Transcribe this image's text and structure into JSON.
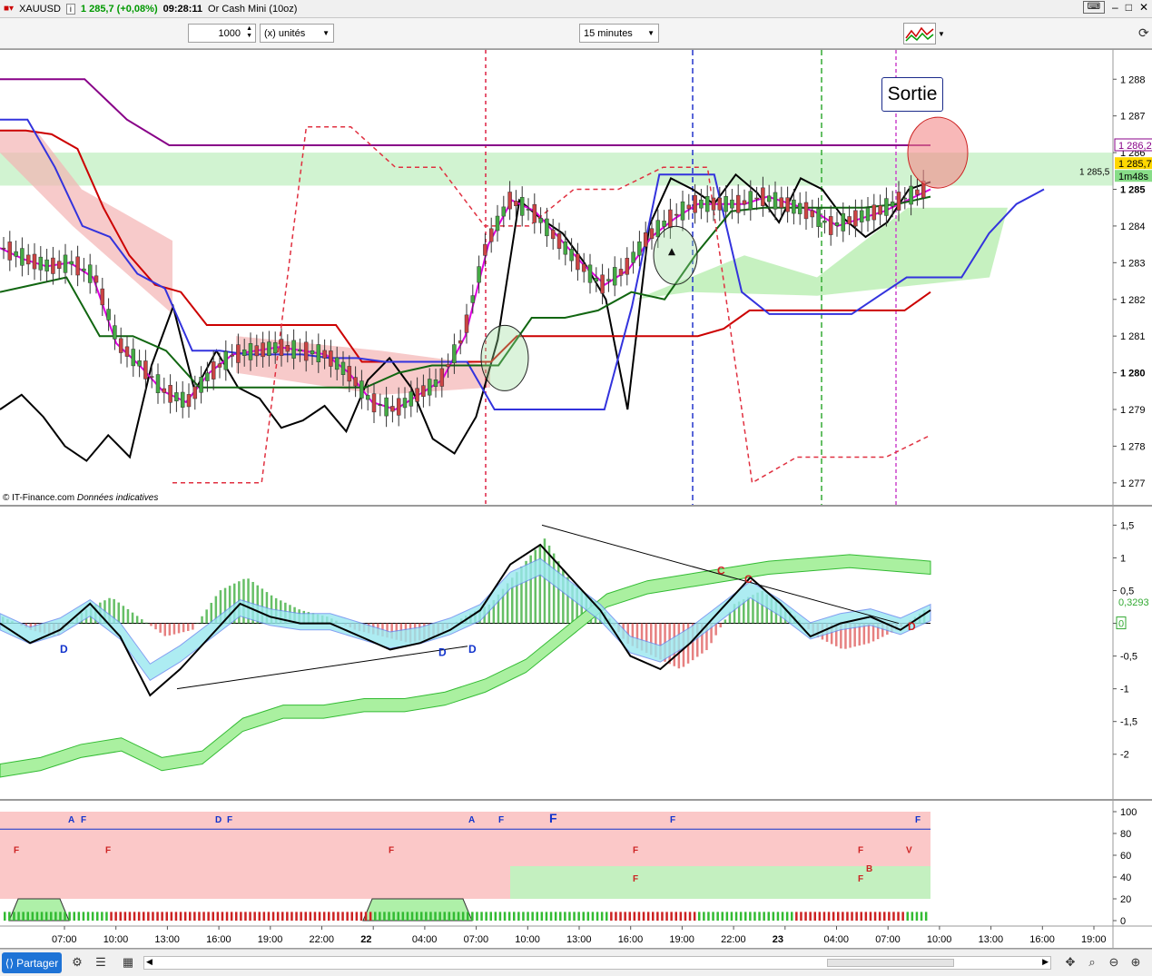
{
  "title_bar": {
    "symbol": "XAUUSD",
    "info_icon": "info-icon",
    "price_change": "1 285,7 (+0,08%)",
    "time": "09:28:11",
    "instrument": "Or Cash Mini (10oz)"
  },
  "toolbar": {
    "quantity": "1000",
    "unit": "(x) unités",
    "timeframe": "15 minutes"
  },
  "annotation": {
    "sortie": "Sortie"
  },
  "watermark": {
    "source": "© IT-Finance.com",
    "note": "Données indicatives"
  },
  "price_labels": {
    "purple": "1 286,2",
    "current": "1 285,7",
    "countdown": "1m48s",
    "band": "1 285,5"
  },
  "osc_labels": {
    "value": "0,3293",
    "zero": "0"
  },
  "lower_letters": {
    "blue": [
      "A",
      "F",
      "D",
      "F",
      "A",
      "F",
      "F",
      "F",
      "F"
    ],
    "red": [
      "F",
      "F",
      "F",
      "F",
      "F",
      "V",
      "F",
      "F",
      "B"
    ]
  },
  "osc_letters": [
    "D",
    "D",
    "D",
    "C",
    "C",
    "D"
  ],
  "statusbar": {
    "share": "Partager"
  },
  "chart_data": [
    {
      "type": "line",
      "title": "",
      "ylim": [
        1276.6,
        1288.6
      ],
      "yticks": [
        "1 288",
        "1 287",
        "1 286",
        "1 285",
        "1 284",
        "1 283",
        "1 282",
        "1 281",
        "1 280",
        "1 279",
        "1 278",
        "1 277"
      ],
      "series": [
        {
          "color": "#000000",
          "values": [
            1279.0,
            1279.4,
            1278.8,
            1278.0,
            1277.6,
            1278.3,
            1277.7,
            1280.2,
            1281.8,
            1279.5,
            1280.6,
            1279.6,
            1279.3,
            1278.5,
            1278.7,
            1279.1,
            1278.4,
            1279.8,
            1280.4,
            1279.6,
            1278.2,
            1277.8,
            1278.8,
            1280.9,
            1284.7,
            1284.2,
            1283.8,
            1283.0,
            1282.0,
            1279.0,
            1284.0,
            1285.3,
            1285.0,
            1284.6,
            1285.4,
            1284.9,
            1284.1,
            1285.3,
            1285.0,
            1284.2,
            1283.7,
            1284.1,
            1285.0,
            1285.2
          ]
        },
        {
          "color": "#e000e0",
          "values": [
            1283.4,
            1283.1,
            1282.9,
            1283.0,
            1282.6,
            1280.8,
            1280.2,
            1279.5,
            1279.2,
            1280.0,
            1280.5,
            1280.6,
            1280.7,
            1280.6,
            1280.5,
            1280.0,
            1279.2,
            1279.0,
            1279.4,
            1279.8,
            1281.0,
            1283.5,
            1284.7,
            1284.4,
            1283.7,
            1283.0,
            1282.4,
            1282.8,
            1283.7,
            1284.2,
            1284.6,
            1284.6,
            1284.6,
            1284.8,
            1284.6,
            1284.4,
            1284.0,
            1284.2,
            1284.4,
            1284.7,
            1285.0
          ]
        },
        {
          "color": "#cc0000",
          "values": [
            1286.6,
            1286.6,
            1286.5,
            1286.1,
            1284.5,
            1283.2,
            1282.4,
            1282.2,
            1281.3,
            1281.3,
            1281.3,
            1281.3,
            1281.3,
            1281.3,
            1280.3,
            1280.3,
            1280.3,
            1280.3,
            1280.3,
            1280.3,
            1281.0,
            1281.0,
            1281.0,
            1281.0,
            1281.0,
            1281.0,
            1281.0,
            1281.0,
            1281.2,
            1281.7,
            1281.7,
            1281.7,
            1281.7,
            1281.7,
            1281.7,
            1281.7,
            1282.2
          ]
        },
        {
          "color": "#880088",
          "values": [
            1288.0,
            1288.0,
            1288.0,
            1286.9,
            1286.2,
            1286.2,
            1286.2,
            1286.2,
            1286.2,
            1286.2,
            1286.2,
            1286.2,
            1286.2,
            1286.2,
            1286.2,
            1286.2,
            1286.2,
            1286.2,
            1286.2,
            1286.2,
            1286.2,
            1286.2,
            1286.2
          ]
        },
        {
          "color": "#3333dd",
          "values": [
            1286.9,
            1286.9,
            1285.6,
            1284.0,
            1283.7,
            1282.7,
            1282.3,
            1280.6,
            1280.6,
            1280.5,
            1280.5,
            1280.5,
            1280.4,
            1280.4,
            1280.3,
            1280.3,
            1280.3,
            1280.3,
            1279.0,
            1279.0,
            1279.0,
            1279.0,
            1279.0,
            1281.8,
            1285.4,
            1285.4,
            1285.4,
            1282.2,
            1281.6,
            1281.6,
            1281.6,
            1281.6,
            1282.1,
            1282.6,
            1282.6,
            1282.6,
            1283.8,
            1284.6,
            1285.0
          ]
        },
        {
          "color": "#116611",
          "values": [
            1282.2,
            1282.4,
            1282.6,
            1281.0,
            1281.0,
            1280.6,
            1279.6,
            1279.6,
            1279.6,
            1279.6,
            1279.6,
            1279.6,
            1280.0,
            1280.2,
            1280.2,
            1280.2,
            1281.5,
            1281.5,
            1281.7,
            1282.2,
            1282.0,
            1283.3,
            1284.4,
            1284.5,
            1284.5,
            1284.5,
            1284.5,
            1284.6,
            1284.8
          ]
        },
        {
          "color": "#e03040",
          "dashed": true,
          "values": [
            1277.0,
            1277.0,
            1277.0,
            1286.7,
            1286.7,
            1285.6,
            1285.6,
            1284.0,
            1284.0,
            1285.0,
            1285.0,
            1285.6,
            1285.6,
            1277.0,
            1277.7,
            1277.7,
            1277.7,
            1278.3
          ]
        }
      ]
    },
    {
      "type": "area",
      "title": "",
      "ylim": [
        -2.6,
        1.7
      ],
      "yticks": [
        "1,5",
        "1",
        "0,5",
        "0",
        "-0,5",
        "-1",
        "-1,5",
        "-2"
      ],
      "histogram": [
        0.1,
        -0.1,
        -0.2,
        0.2,
        0.4,
        0.1,
        -0.2,
        -0.1,
        0.5,
        0.7,
        0.4,
        0.2,
        0.1,
        -0.1,
        -0.2,
        -0.3,
        -0.2,
        0.1,
        0.3,
        0.8,
        1.3,
        0.6,
        0.3,
        -0.3,
        -0.5,
        -0.7,
        -0.4,
        0.3,
        0.5,
        0.2,
        -0.2,
        -0.4,
        -0.3,
        -0.1,
        0.2
      ],
      "series": [
        {
          "color": "#000000",
          "values": [
            0.0,
            -0.3,
            -0.1,
            0.3,
            -0.2,
            -1.1,
            -0.7,
            -0.2,
            0.3,
            0.1,
            0.0,
            0.0,
            -0.2,
            -0.4,
            -0.3,
            -0.1,
            0.2,
            0.9,
            1.2,
            0.7,
            0.2,
            -0.5,
            -0.7,
            -0.3,
            0.2,
            0.7,
            0.3,
            -0.2,
            0.0,
            0.1,
            -0.1,
            0.2
          ]
        },
        {
          "color": "#33bb33",
          "values": [
            -2.3,
            -2.2,
            -2.0,
            -1.9,
            -2.2,
            -2.1,
            -1.6,
            -1.4,
            -1.4,
            -1.3,
            -1.3,
            -1.2,
            -1.0,
            -0.7,
            -0.2,
            0.3,
            0.5,
            0.6,
            0.7,
            0.8,
            0.85,
            0.9,
            0.85,
            0.8
          ]
        }
      ]
    },
    {
      "type": "area",
      "title": "",
      "ylim": [
        -5,
        105
      ],
      "yticks": [
        "100",
        "80",
        "60",
        "40",
        "20",
        "0"
      ],
      "x_labels": [
        "07:00",
        "10:00",
        "13:00",
        "16:00",
        "19:00",
        "22:00",
        "22",
        "04:00",
        "07:00",
        "10:00",
        "13:00",
        "16:00",
        "19:00",
        "22:00",
        "23",
        "04:00",
        "07:00",
        "10:00",
        "13:00",
        "16:00",
        "19:00"
      ]
    }
  ]
}
